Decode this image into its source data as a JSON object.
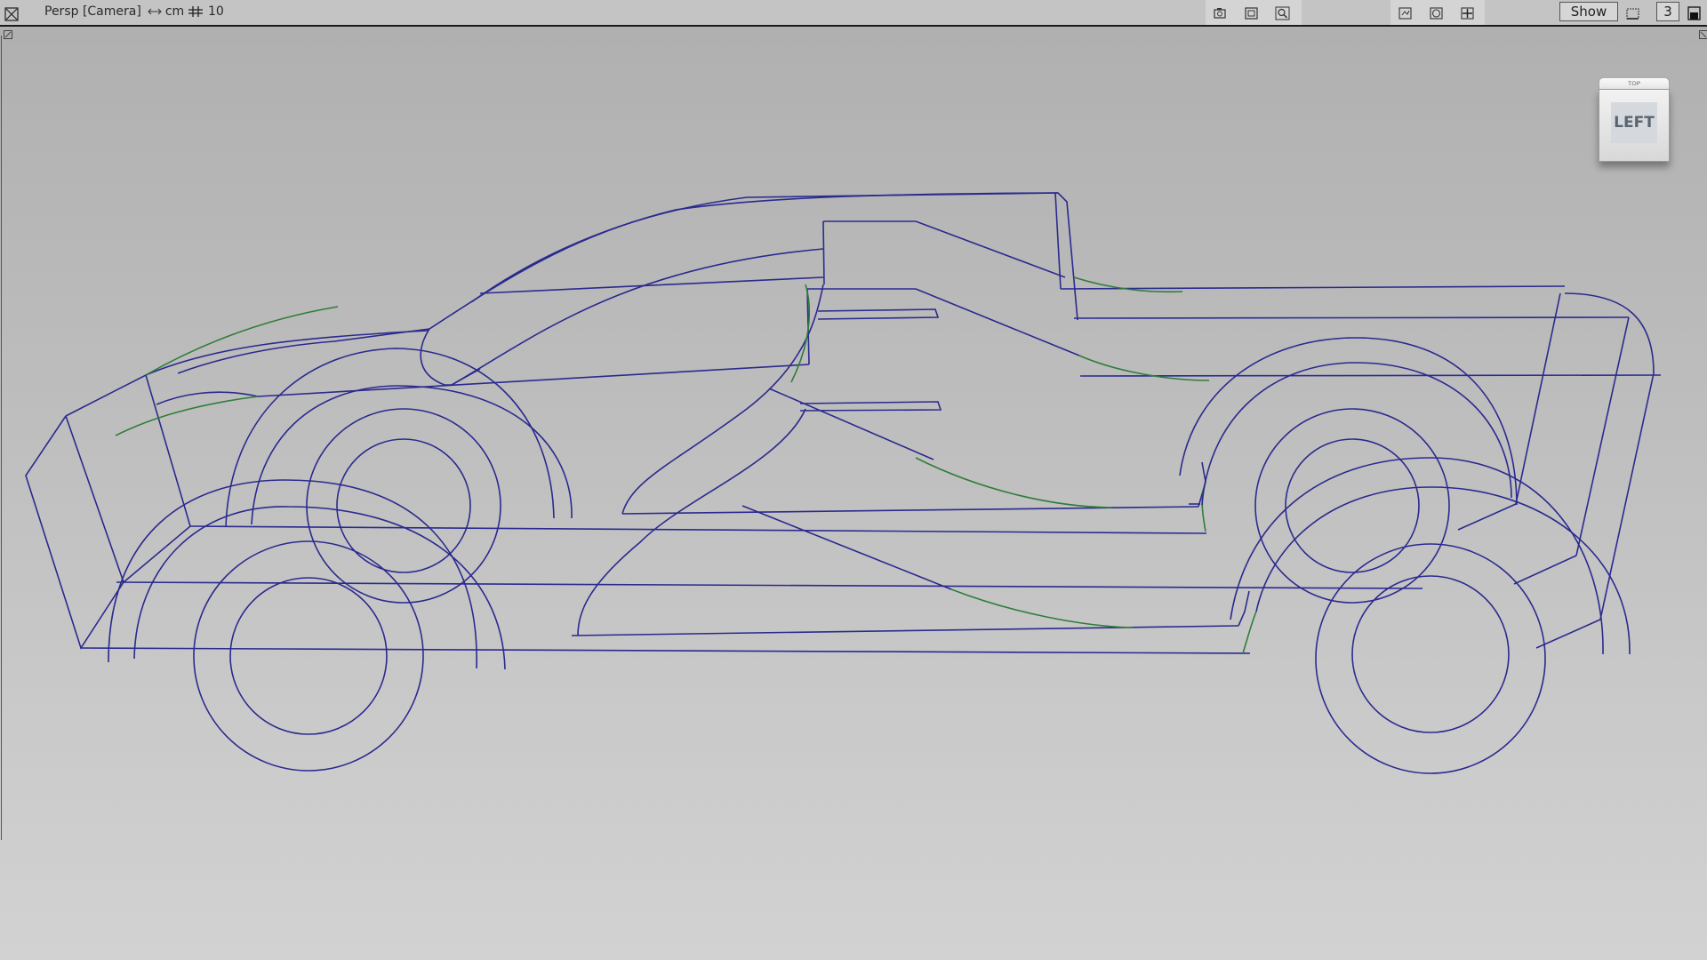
{
  "toolbar": {
    "camera_label": "Persp [Camera]",
    "unit_label": "cm",
    "grid_label": "10",
    "show_label": "Show",
    "count_value": "3"
  },
  "viewcube": {
    "face_label": "LEFT",
    "top_label": "TOP"
  },
  "colors": {
    "curve": "#2a2a8f",
    "curve_highlight": "#2e7d3a",
    "viewport_top": "#b0b0b0",
    "viewport_bottom": "#d2d2d2"
  },
  "icons": {
    "close": "close-icon",
    "unit_arrows": "double-arrow-icon",
    "grid": "grid-icon",
    "camera_tool": "camera-icon",
    "frame_tool": "frame-icon",
    "zoom_tool": "zoom-icon",
    "display_a": "display-toggle-icon",
    "display_b": "isolate-icon",
    "display_c": "pan-icon",
    "layout": "layout-icon",
    "maximize": "maximize-icon"
  }
}
